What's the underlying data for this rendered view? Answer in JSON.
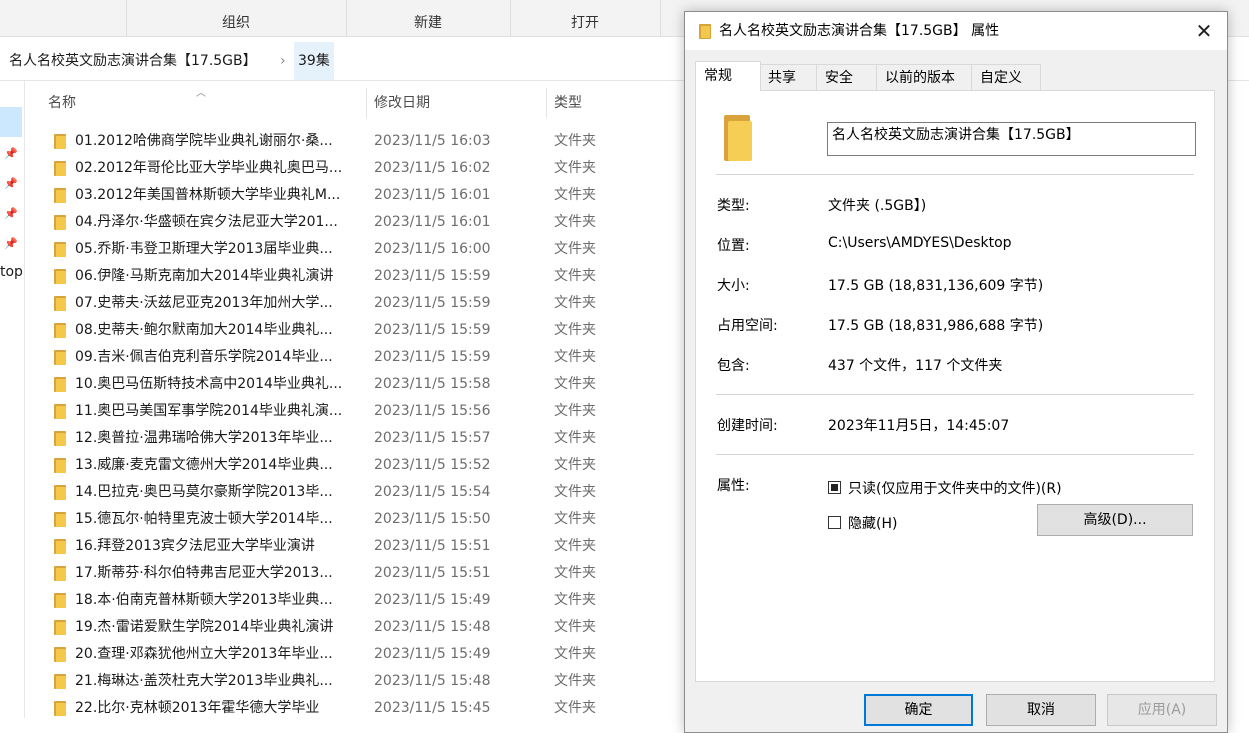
{
  "ribbon": {
    "groups": [
      "组织",
      "新建",
      "打开"
    ]
  },
  "address": {
    "parent": "名人名校英文励志演讲合集【17.5GB】",
    "current": "39集"
  },
  "nav": {
    "partial_label": "top"
  },
  "columns": {
    "name": "名称",
    "date": "修改日期",
    "type": "类型"
  },
  "files": [
    {
      "name": "01.2012哈佛商学院毕业典礼谢丽尔·桑...",
      "date": "2023/11/5 16:03",
      "type": "文件夹"
    },
    {
      "name": "02.2012年哥伦比亚大学毕业典礼奥巴马...",
      "date": "2023/11/5 16:02",
      "type": "文件夹"
    },
    {
      "name": "03.2012年美国普林斯顿大学毕业典礼M...",
      "date": "2023/11/5 16:01",
      "type": "文件夹"
    },
    {
      "name": "04.丹泽尔·华盛顿在宾夕法尼亚大学201...",
      "date": "2023/11/5 16:01",
      "type": "文件夹"
    },
    {
      "name": "05.乔斯·韦登卫斯理大学2013届毕业典...",
      "date": "2023/11/5 16:00",
      "type": "文件夹"
    },
    {
      "name": "06.伊隆·马斯克南加大2014毕业典礼演讲",
      "date": "2023/11/5 15:59",
      "type": "文件夹"
    },
    {
      "name": "07.史蒂夫·沃兹尼亚克2013年加州大学...",
      "date": "2023/11/5 15:59",
      "type": "文件夹"
    },
    {
      "name": "08.史蒂夫·鲍尔默南加大2014毕业典礼...",
      "date": "2023/11/5 15:59",
      "type": "文件夹"
    },
    {
      "name": "09.吉米·佩吉伯克利音乐学院2014毕业...",
      "date": "2023/11/5 15:59",
      "type": "文件夹"
    },
    {
      "name": "10.奥巴马伍斯特技术高中2014毕业典礼...",
      "date": "2023/11/5 15:58",
      "type": "文件夹"
    },
    {
      "name": "11.奥巴马美国军事学院2014毕业典礼演...",
      "date": "2023/11/5 15:56",
      "type": "文件夹"
    },
    {
      "name": "12.奥普拉·温弗瑞哈佛大学2013年毕业...",
      "date": "2023/11/5 15:57",
      "type": "文件夹"
    },
    {
      "name": "13.威廉·麦克雷文德州大学2014毕业典...",
      "date": "2023/11/5 15:52",
      "type": "文件夹"
    },
    {
      "name": "14.巴拉克·奥巴马莫尔豪斯学院2013毕...",
      "date": "2023/11/5 15:54",
      "type": "文件夹"
    },
    {
      "name": "15.德瓦尔·帕特里克波士顿大学2014毕...",
      "date": "2023/11/5 15:50",
      "type": "文件夹"
    },
    {
      "name": "16.拜登2013宾夕法尼亚大学毕业演讲",
      "date": "2023/11/5 15:51",
      "type": "文件夹"
    },
    {
      "name": "17.斯蒂芬·科尔伯特弗吉尼亚大学2013...",
      "date": "2023/11/5 15:51",
      "type": "文件夹"
    },
    {
      "name": "18.本·伯南克普林斯顿大学2013毕业典...",
      "date": "2023/11/5 15:49",
      "type": "文件夹"
    },
    {
      "name": "19.杰·雷诺爱默生学院2014毕业典礼演讲",
      "date": "2023/11/5 15:48",
      "type": "文件夹"
    },
    {
      "name": "20.查理·邓森犹他州立大学2013年毕业...",
      "date": "2023/11/5 15:49",
      "type": "文件夹"
    },
    {
      "name": "21.梅琳达·盖茨杜克大学2013毕业典礼...",
      "date": "2023/11/5 15:48",
      "type": "文件夹"
    },
    {
      "name": "22.比尔·克林顿2013年霍华德大学毕业",
      "date": "2023/11/5 15:45",
      "type": "文件夹"
    }
  ],
  "dialog": {
    "title": "名人名校英文励志演讲合集【17.5GB】 属性",
    "tabs": [
      "常规",
      "共享",
      "安全",
      "以前的版本",
      "自定义"
    ],
    "folder_name": "名人名校英文励志演讲合集【17.5GB】",
    "rows": [
      {
        "label": "类型:",
        "value": "文件夹 (.5GB】)"
      },
      {
        "label": "位置:",
        "value": "C:\\Users\\AMDYES\\Desktop"
      },
      {
        "label": "大小:",
        "value": "17.5 GB (18,831,136,609 字节)"
      },
      {
        "label": "占用空间:",
        "value": "17.5 GB (18,831,986,688 字节)"
      },
      {
        "label": "包含:",
        "value": "437 个文件，117 个文件夹"
      }
    ],
    "created": {
      "label": "创建时间:",
      "value": "2023年11月5日，14:45:07"
    },
    "attributes": {
      "label": "属性:",
      "readonly": "只读(仅应用于文件夹中的文件)(R)",
      "hidden": "隐藏(H)",
      "advanced": "高级(D)..."
    },
    "buttons": {
      "ok": "确定",
      "cancel": "取消",
      "apply": "应用(A)"
    }
  }
}
